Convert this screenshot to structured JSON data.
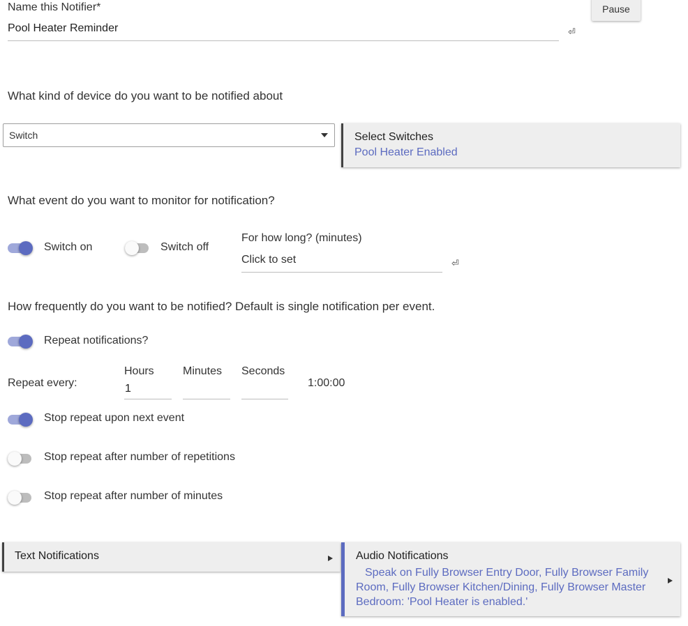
{
  "notifier": {
    "name_label": "Name this Notifier*",
    "name_value": "Pool Heater Reminder",
    "pause_label": "Pause"
  },
  "device": {
    "question": "What kind of device do you want to be notified about",
    "select_value": "Switch",
    "select_switches_title": "Select Switches",
    "select_switches_value": "Pool Heater Enabled"
  },
  "event": {
    "question": "What event do you want to monitor for notification?",
    "switch_on_label": "Switch on",
    "switch_on_state": true,
    "switch_off_label": "Switch off",
    "switch_off_state": false,
    "duration_label": "For how long? (minutes)",
    "duration_placeholder": "Click to set"
  },
  "frequency": {
    "question": "How frequently do you want to be notified?  Default is single notification per event.",
    "repeat_label": "Repeat notifications?",
    "repeat_state": true,
    "repeat_every_label": "Repeat every:",
    "hours_label": "Hours",
    "hours_value": "1",
    "minutes_label": "Minutes",
    "minutes_value": "",
    "seconds_label": "Seconds",
    "seconds_value": "",
    "total_display": "1:00:00",
    "stop_next_event_label": "Stop repeat upon next event",
    "stop_next_event_state": true,
    "stop_repetitions_label": "Stop repeat after number of repetitions",
    "stop_repetitions_state": false,
    "stop_minutes_label": "Stop repeat after number of minutes",
    "stop_minutes_state": false
  },
  "notifications": {
    "text_title": "Text Notifications",
    "audio_title": "Audio Notifications",
    "audio_value": "Speak on  Fully Browser Entry Door, Fully Browser Family Room, Fully Browser Kitchen/Dining, Fully Browser Master Bedroom: 'Pool Heater is enabled.'"
  },
  "colors": {
    "accent": "#5c6bc0",
    "accent_track": "#9fa8da",
    "card_bg": "#eeeeee",
    "card_border": "#424242"
  },
  "icons": {
    "enter": "enter-key-icon",
    "dropdown": "chevron-down-icon",
    "submenu": "play-arrow-icon"
  }
}
